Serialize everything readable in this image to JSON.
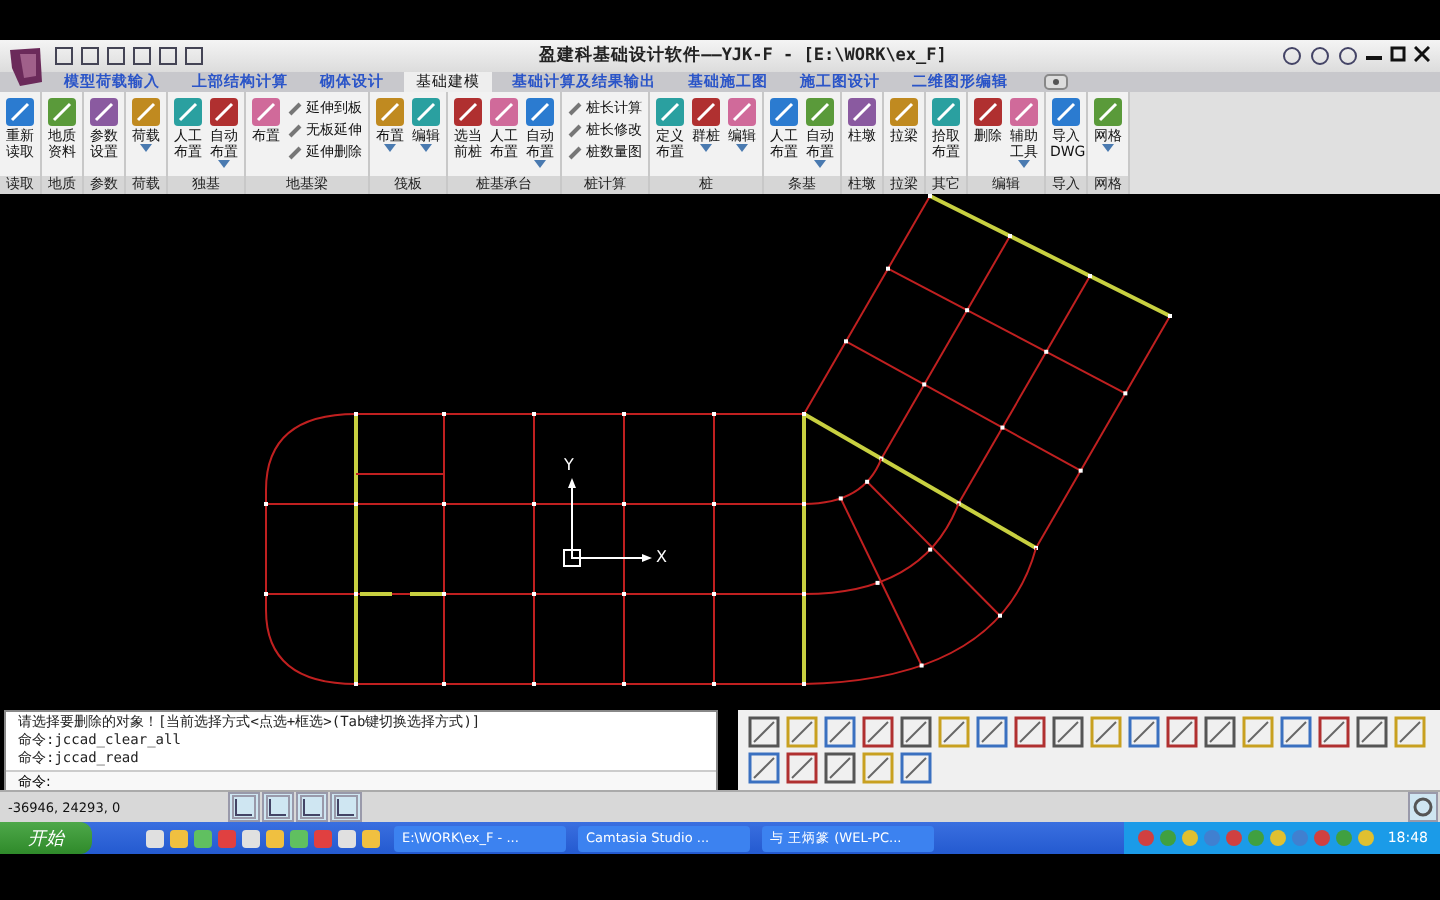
{
  "window": {
    "title": "盈建科基础设计软件——YJK-F - [E:\\WORK\\ex_F]"
  },
  "tabs": [
    {
      "label": "模型荷载输入",
      "selected": false
    },
    {
      "label": "上部结构计算",
      "selected": false
    },
    {
      "label": "砌体设计",
      "selected": false
    },
    {
      "label": "基础建模",
      "selected": true
    },
    {
      "label": "基础计算及结果输出",
      "selected": false
    },
    {
      "label": "基础施工图",
      "selected": false
    },
    {
      "label": "施工图设计",
      "selected": false
    },
    {
      "label": "二维图形编辑",
      "selected": false
    }
  ],
  "ribbon": [
    {
      "label": "读取",
      "buttons": [
        {
          "kind": "large",
          "label": "重新读取",
          "dropdown": false
        }
      ]
    },
    {
      "label": "地质",
      "buttons": [
        {
          "kind": "large",
          "label": "地质资料",
          "dropdown": false
        }
      ]
    },
    {
      "label": "参数",
      "buttons": [
        {
          "kind": "large",
          "label": "参数设置",
          "dropdown": false
        }
      ]
    },
    {
      "label": "荷载",
      "buttons": [
        {
          "kind": "large",
          "label": "荷载",
          "dropdown": true
        }
      ]
    },
    {
      "label": "独基",
      "buttons": [
        {
          "kind": "large",
          "label": "人工布置",
          "dropdown": false
        },
        {
          "kind": "large",
          "label": "自动布置",
          "dropdown": true
        }
      ]
    },
    {
      "label": "地基梁",
      "buttons": [
        {
          "kind": "large",
          "label": "布置",
          "dropdown": false
        },
        {
          "kind": "small",
          "label": "延伸到板",
          "dropdown": false
        },
        {
          "kind": "small",
          "label": "无板延伸",
          "dropdown": false
        },
        {
          "kind": "small",
          "label": "延伸删除",
          "dropdown": false
        }
      ]
    },
    {
      "label": "筏板",
      "buttons": [
        {
          "kind": "large",
          "label": "布置",
          "dropdown": true
        },
        {
          "kind": "large",
          "label": "编辑",
          "dropdown": true
        }
      ]
    },
    {
      "label": "桩基承台",
      "buttons": [
        {
          "kind": "large",
          "label": "选当前桩",
          "dropdown": false
        },
        {
          "kind": "large",
          "label": "人工布置",
          "dropdown": false
        },
        {
          "kind": "large",
          "label": "自动布置",
          "dropdown": true
        }
      ]
    },
    {
      "label": "桩计算",
      "buttons": [
        {
          "kind": "small",
          "label": "桩长计算",
          "dropdown": false
        },
        {
          "kind": "small",
          "label": "桩长修改",
          "dropdown": false
        },
        {
          "kind": "small",
          "label": "桩数量图",
          "dropdown": false
        }
      ]
    },
    {
      "label": "桩",
      "buttons": [
        {
          "kind": "large",
          "label": "定义布置",
          "dropdown": false
        },
        {
          "kind": "large",
          "label": "群桩",
          "dropdown": true
        },
        {
          "kind": "large",
          "label": "编辑",
          "dropdown": true
        }
      ]
    },
    {
      "label": "条基",
      "buttons": [
        {
          "kind": "large",
          "label": "人工布置",
          "dropdown": false
        },
        {
          "kind": "large",
          "label": "自动布置",
          "dropdown": true
        }
      ]
    },
    {
      "label": "柱墩",
      "buttons": [
        {
          "kind": "large",
          "label": "柱墩",
          "dropdown": false
        }
      ]
    },
    {
      "label": "拉梁",
      "buttons": [
        {
          "kind": "large",
          "label": "拉梁",
          "dropdown": false
        }
      ]
    },
    {
      "label": "其它",
      "buttons": [
        {
          "kind": "large",
          "label": "拾取布置",
          "dropdown": false
        }
      ]
    },
    {
      "label": "编辑",
      "buttons": [
        {
          "kind": "large",
          "label": "删除",
          "dropdown": false
        },
        {
          "kind": "large",
          "label": "辅助工具",
          "dropdown": true
        }
      ]
    },
    {
      "label": "导入",
      "buttons": [
        {
          "kind": "large",
          "label": "导入DWG",
          "dropdown": false
        }
      ]
    },
    {
      "label": "网格",
      "buttons": [
        {
          "kind": "large",
          "label": "网格",
          "dropdown": true
        }
      ]
    }
  ],
  "canvas": {
    "axis_labels": [
      "Y",
      "X"
    ]
  },
  "command": {
    "history": [
      "请选择要删除的对象！[当前选择方式<点选+框选>(Tab键切换选择方式)]",
      "命令:jccad_clear_all",
      "命令:jccad_read"
    ],
    "prompt": "命令:"
  },
  "status_bar": {
    "coordinates": "-36946, 24293, 0"
  },
  "taskbar": {
    "start": "开始",
    "windows": [
      {
        "label": "E:\\WORK\\ex_F - ...",
        "selected": false
      },
      {
        "label": "Camtasia Studio ...",
        "selected": false
      },
      {
        "label": "与 王炳篆 (WEL-PC...",
        "selected": false
      }
    ],
    "clock": "18:48"
  }
}
